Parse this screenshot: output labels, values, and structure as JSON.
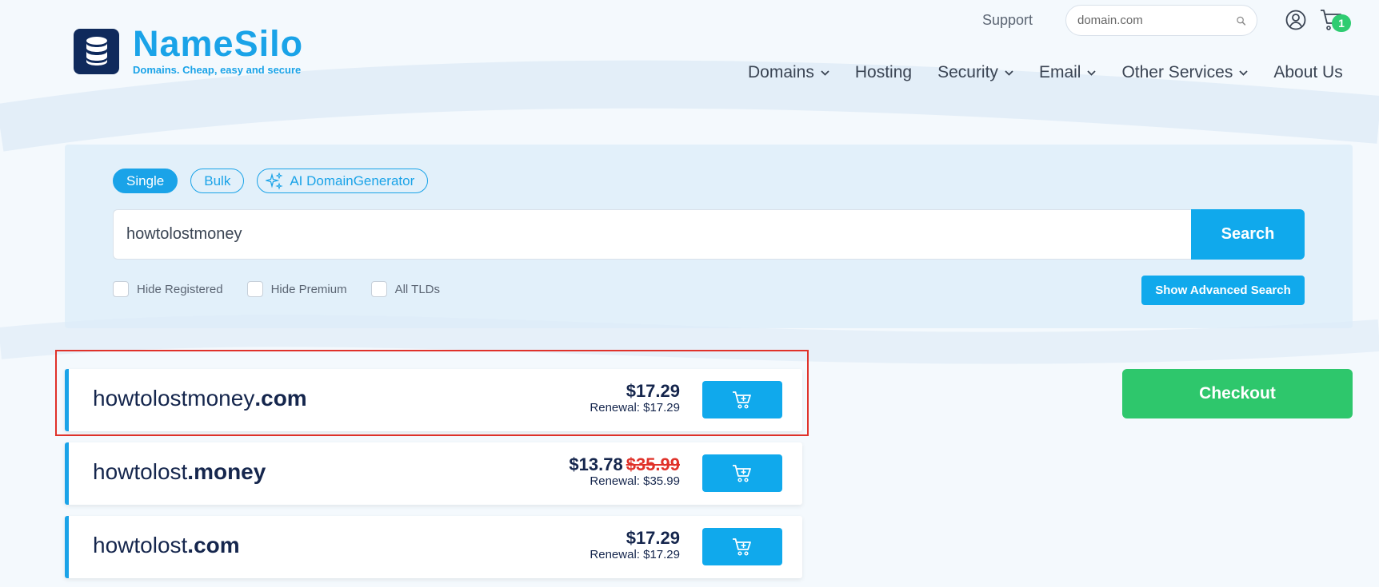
{
  "brand": {
    "name": "NameSilo",
    "tagline": "Domains. Cheap, easy and secure"
  },
  "header": {
    "support_label": "Support",
    "search_placeholder": "domain.com",
    "cart_count": "1"
  },
  "nav": {
    "items": [
      {
        "label": "Domains",
        "has_dropdown": true
      },
      {
        "label": "Hosting",
        "has_dropdown": false
      },
      {
        "label": "Security",
        "has_dropdown": true
      },
      {
        "label": "Email",
        "has_dropdown": true
      },
      {
        "label": "Other Services",
        "has_dropdown": true
      },
      {
        "label": "About Us",
        "has_dropdown": false
      }
    ]
  },
  "search_panel": {
    "modes": [
      {
        "label": "Single",
        "active": true
      },
      {
        "label": "Bulk",
        "active": false
      },
      {
        "label": "AI DomainGenerator",
        "active": false
      }
    ],
    "query": "howtolostmoney",
    "search_label": "Search",
    "filters": [
      {
        "label": "Hide Registered",
        "checked": false
      },
      {
        "label": "Hide Premium",
        "checked": false
      },
      {
        "label": "All TLDs",
        "checked": false
      }
    ],
    "advanced_label": "Show Advanced Search"
  },
  "results": [
    {
      "sld": "howtolostmoney",
      "tld": ".com",
      "price": "$17.29",
      "old_price": "",
      "renewal": "Renewal: $17.29"
    },
    {
      "sld": "howtolost",
      "tld": ".money",
      "price": "$13.78",
      "old_price": "$35.99",
      "renewal": "Renewal: $35.99"
    },
    {
      "sld": "howtolost",
      "tld": ".com",
      "price": "$17.29",
      "old_price": "",
      "renewal": "Renewal: $17.29"
    }
  ],
  "checkout_label": "Checkout",
  "colors": {
    "accent": "#10a9ec",
    "brand_dark": "#0f2a5c",
    "checkout": "#2ec76c",
    "highlight": "#e0322a"
  }
}
